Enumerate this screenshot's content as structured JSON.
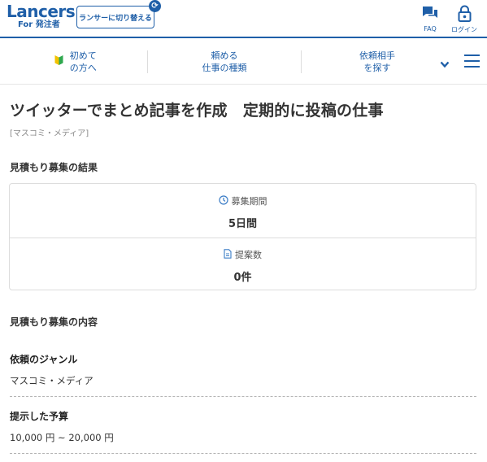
{
  "header": {
    "logo_main": "Lancers",
    "logo_sub": "For 発注者",
    "switch_label": "ランサーに切り替える",
    "faq_label": "FAQ",
    "login_label": "ログイン"
  },
  "nav": {
    "items": [
      {
        "line1": "初めて",
        "line2": "の方へ"
      },
      {
        "line1": "頼める",
        "line2": "仕事の種類"
      },
      {
        "line1": "依頼相手",
        "line2": "を探す"
      }
    ]
  },
  "job": {
    "title": "ツイッターでまとめ記事を作成　定期的に投稿の仕事",
    "category": "[マスコミ・メディア]"
  },
  "result": {
    "heading": "見積もり募集の結果",
    "period_label": "募集期間",
    "period_value": "5日間",
    "proposals_label": "提案数",
    "proposals_value": "0件"
  },
  "content": {
    "heading": "見積もり募集の内容",
    "genre_label": "依頼のジャンル",
    "genre_value": "マスコミ・メディア",
    "budget_label": "提示した予算",
    "budget_value": "10,000 円 ~ 20,000 円"
  },
  "colors": {
    "brand": "#1f5fa8",
    "text": "#333333",
    "border": "#dcdcdc"
  }
}
